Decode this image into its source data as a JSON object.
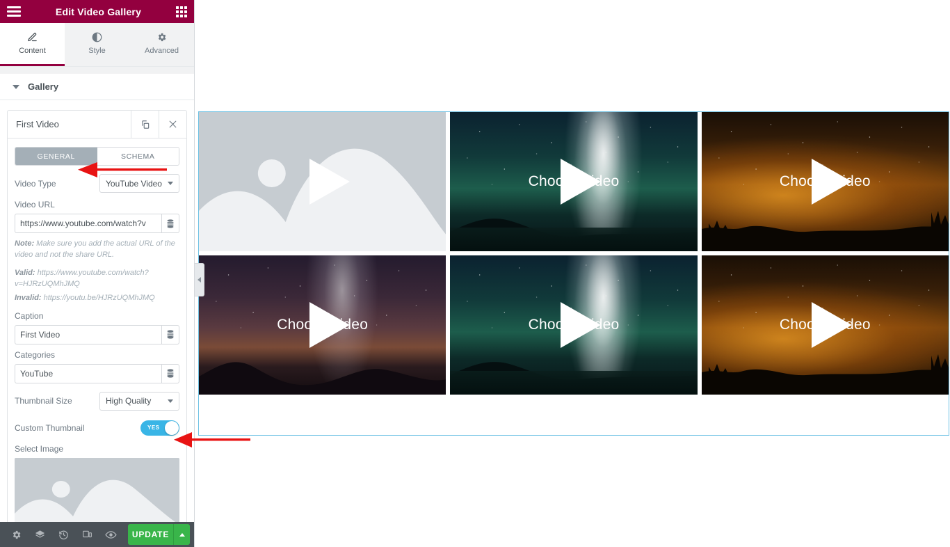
{
  "panel": {
    "header": {
      "title": "Edit Video Gallery",
      "menu_icon": "hamburger-icon",
      "apps_icon": "apps-grid-icon"
    },
    "tabs": [
      {
        "label": "Content",
        "icon": "pencil-icon",
        "active": true
      },
      {
        "label": "Style",
        "icon": "contrast-circle-icon",
        "active": false
      },
      {
        "label": "Advanced",
        "icon": "gear-icon",
        "active": false
      }
    ],
    "section": {
      "label": "Gallery",
      "caret": "chevron-down-icon"
    },
    "repeater": {
      "title": "First Video",
      "duplicate_icon": "duplicate-icon",
      "remove_icon": "close-icon",
      "segments": [
        {
          "label": "GENERAL",
          "active": true
        },
        {
          "label": "SCHEMA",
          "active": false
        }
      ],
      "fields": {
        "video_type_label": "Video Type",
        "video_type_value": "YouTube Video",
        "video_url_label": "Video URL",
        "video_url_value": "https://www.youtube.com/watch?v",
        "note_prefix": "Note:",
        "note_text": " Make sure you add the actual URL of the video and not the share URL.",
        "valid_prefix": "Valid:",
        "valid_text": " https://www.youtube.com/watch?v=HJRzUQMhJMQ",
        "invalid_prefix": "Invalid:",
        "invalid_text": " https://youtu.be/HJRzUQMhJMQ",
        "caption_label": "Caption",
        "caption_value": "First Video",
        "categories_label": "Categories",
        "categories_value": "YouTube",
        "thumbnail_size_label": "Thumbnail Size",
        "thumbnail_size_value": "High Quality",
        "custom_thumbnail_label": "Custom Thumbnail",
        "custom_thumbnail_state": "YES",
        "select_image_label": "Select Image",
        "dynamic_tag_icon": "dynamic-tags-icon"
      }
    },
    "footer": {
      "icons": [
        "settings-gear-icon",
        "navigator-layers-icon",
        "history-clock-icon",
        "responsive-mode-icon",
        "preview-eye-icon"
      ],
      "update_label": "UPDATE",
      "update_caret_icon": "chevron-up-icon"
    }
  },
  "canvas": {
    "collapse_handle_icon": "chevron-left-icon",
    "tiles": [
      {
        "caption": "",
        "scene": "placeholder",
        "play_icon": "play-icon"
      },
      {
        "caption": "Choose video",
        "scene": "green-milkyway",
        "play_icon": "play-icon"
      },
      {
        "caption": "Choose video",
        "scene": "orange-night",
        "play_icon": "play-icon"
      },
      {
        "caption": "Choose video",
        "scene": "purple-milkyway",
        "play_icon": "play-icon"
      },
      {
        "caption": "Choose video",
        "scene": "green-milkyway",
        "play_icon": "play-icon"
      },
      {
        "caption": "Choose video",
        "scene": "orange-night",
        "play_icon": "play-icon"
      }
    ]
  },
  "annotations": [
    {
      "name": "arrow-to-general-tab",
      "color": "#e81313"
    },
    {
      "name": "arrow-to-custom-thumbnail-toggle",
      "color": "#e81313"
    }
  ],
  "colors": {
    "header_bg": "#93003f",
    "accent_toggle": "#39b5e6",
    "update_green": "#39b54a",
    "selection_border": "#6ec1e4",
    "footer_bg": "#4a5157",
    "arrow_red": "#e81313"
  }
}
